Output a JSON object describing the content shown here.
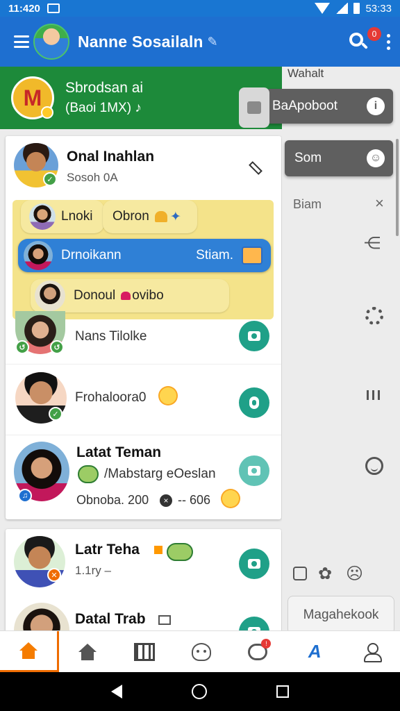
{
  "status_bar": {
    "time": "11:420",
    "right_text": "53:33"
  },
  "app_bar": {
    "title": "Nanne Sosailaln",
    "search_badge": "0"
  },
  "banner": {
    "title": "Sbrodsan ai",
    "subtitle": "(Baoi 1MX)",
    "logo_letter": "M"
  },
  "card1": {
    "header": {
      "name": "Onal Inahlan",
      "sub": "Sosoh 0A"
    },
    "bubbles": [
      {
        "label": "Lnoki"
      },
      {
        "label": "Obron"
      },
      {
        "label": "Drnoikann",
        "right": "Stiam."
      },
      {
        "label": "Donoul",
        "suffix": "ovibo"
      }
    ],
    "rows": [
      {
        "text": "Nans Tilolke"
      },
      {
        "text": "Frohaloora0"
      },
      {
        "name": "Latat Teman",
        "line1": "/Mabstarg eOeslan",
        "line2_a": "Obnoba. 200",
        "line2_b": "-- 606"
      }
    ]
  },
  "card2": {
    "rows": [
      {
        "name": "Latr Teha",
        "sub": "1.1ry –"
      },
      {
        "name": "Datal Trab"
      }
    ]
  },
  "right_panel": {
    "title": "Wahalt",
    "pill1": "BaApoboot",
    "pill2": "Som",
    "label": "Biam",
    "button": "Magahekook"
  },
  "colors": {
    "app_bar": "#1e6fd0",
    "banner": "#1d8a3a",
    "teal": "#1fa088",
    "yellow": "#f4e38a",
    "bubble_blue": "#2f80d6",
    "active_nav": "#f57c00"
  },
  "icons": {
    "nav": [
      "home-icon-active",
      "home-icon",
      "grid-icon",
      "robot-icon",
      "chat-icon",
      "ax-icon",
      "user-icon"
    ],
    "right": [
      "share-icon",
      "gear-icon",
      "bars-icon",
      "face-icon"
    ]
  }
}
